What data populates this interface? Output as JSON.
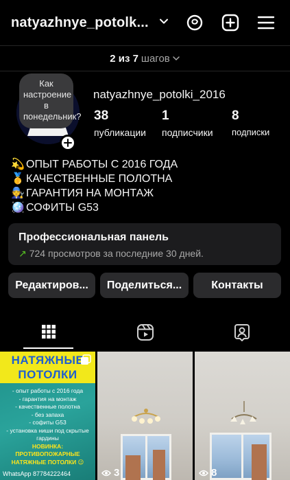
{
  "header": {
    "handle": "natyazhnye_potolk...",
    "icons": [
      "chevron-down-icon",
      "threads-icon",
      "add-post-icon",
      "menu-icon"
    ]
  },
  "steps": {
    "progress": "2 из 7",
    "label": "шагов"
  },
  "profile": {
    "avatar_bubble": "Как настроение в понедельник?",
    "username": "natyazhnye_potolki_2016",
    "stats": [
      {
        "value": "38",
        "label": "публикации"
      },
      {
        "value": "1",
        "label": "подписчики"
      },
      {
        "value": "8",
        "label": "подписки"
      }
    ],
    "bio": [
      {
        "icon": "💫",
        "text": "ОПЫТ РАБОТЫ С 2016 ГОДА"
      },
      {
        "icon": "🥇",
        "text": "КАЧЕСТВЕННЫЕ ПОЛОТНА"
      },
      {
        "icon": "🧑‍🔧",
        "text": "ГАРАНТИЯ НА МОНТАЖ"
      },
      {
        "icon": "🪩",
        "text": "СОФИТЫ G53"
      }
    ]
  },
  "pro_panel": {
    "title": "Профессиональная панель",
    "subtitle": "724 просмотров за последние 30 дней."
  },
  "actions": {
    "edit": "Редактиров...",
    "share": "Поделиться...",
    "contacts": "Контакты"
  },
  "tabs": [
    {
      "name": "grid",
      "icon": "grid-icon",
      "active": true
    },
    {
      "name": "reels",
      "icon": "reels-icon",
      "active": false
    },
    {
      "name": "tagged",
      "icon": "tagged-icon",
      "active": false
    }
  ],
  "posts": [
    {
      "headline": "НАТЯЖНЫЕ ПОТОЛКИ",
      "lines": [
        "- опыт работы с 2016 года",
        "- гарантия на монтаж",
        "- качественные полотна",
        "- без запаха",
        "- софиты G53",
        "- установка ниши под скрытые гардины"
      ],
      "highlight": "НОВИНКА: ПРОТИВОПОЖАРНЫЕ НАТЯЖНЫЕ ПОТОЛКИ 😉",
      "phone": "WhatsApp 87784222464",
      "views": ""
    },
    {
      "views": "3"
    },
    {
      "views": "8"
    }
  ],
  "colors": {
    "background": "#000000",
    "card": "#1c1c1e",
    "button": "#2b2b2d",
    "trend": "#58c322",
    "muted": "#a8a8a8"
  }
}
